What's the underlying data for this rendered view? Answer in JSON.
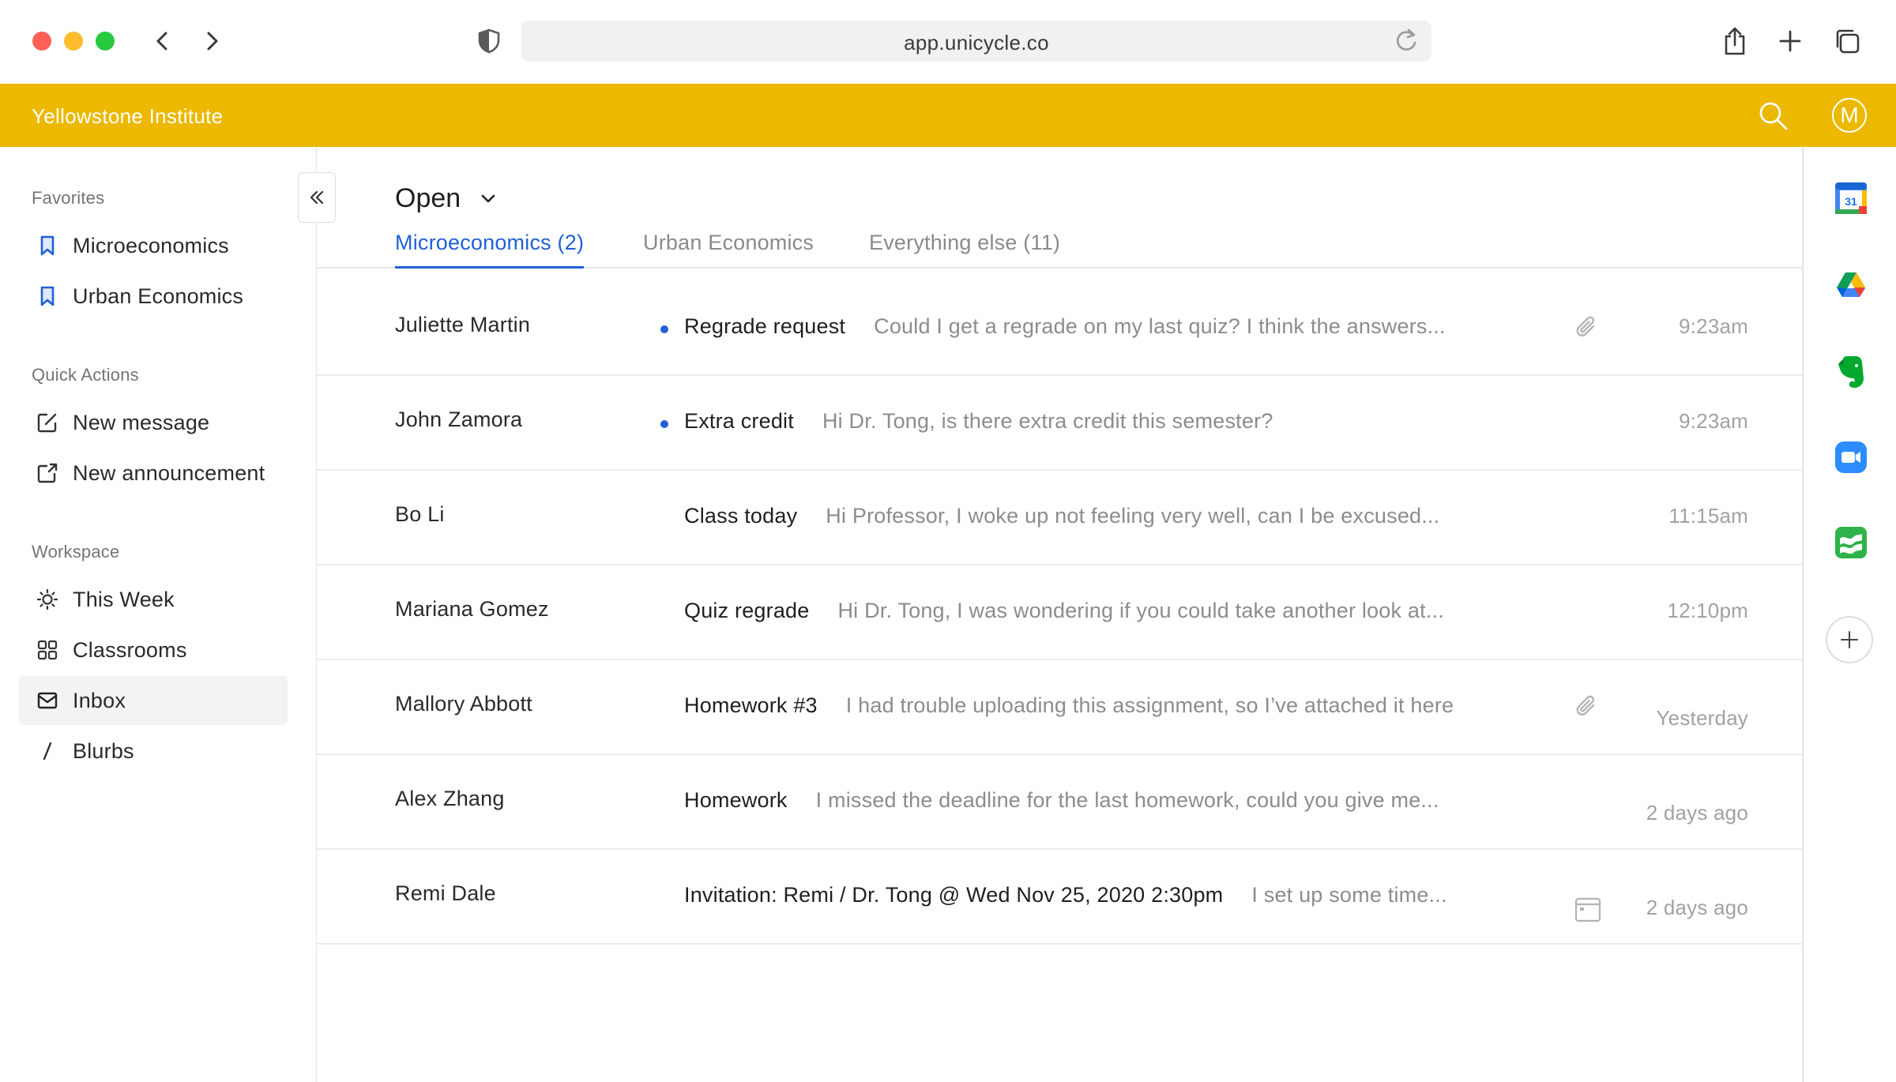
{
  "browser": {
    "url": "app.unicycle.co",
    "icons": [
      "back-icon",
      "forward-icon",
      "shield-icon",
      "reload-icon",
      "share-icon",
      "plus-icon",
      "tabs-icon"
    ]
  },
  "appbar": {
    "org_name": "Yellowstone Institute",
    "avatar_initial": "M",
    "accent_color": "#ecb800"
  },
  "sidebar": {
    "favorites_title": "Favorites",
    "favorites": [
      {
        "label": "Microeconomics",
        "icon": "bookmark-icon"
      },
      {
        "label": "Urban Economics",
        "icon": "bookmark-icon"
      }
    ],
    "quick_actions_title": "Quick Actions",
    "quick_actions": [
      {
        "label": "New message",
        "icon": "compose-icon"
      },
      {
        "label": "New announcement",
        "icon": "announcement-icon"
      }
    ],
    "workspace_title": "Workspace",
    "workspace": [
      {
        "label": "This Week",
        "icon": "sun-icon"
      },
      {
        "label": "Classrooms",
        "icon": "grid-icon"
      },
      {
        "label": "Inbox",
        "icon": "mail-icon",
        "active": true
      },
      {
        "label": "Blurbs",
        "icon": "slash-icon"
      }
    ]
  },
  "main": {
    "view_title": "Open",
    "tabs": [
      {
        "label": "Microeconomics (2)",
        "active": true
      },
      {
        "label": "Urban Economics"
      },
      {
        "label": "Everything else (11)"
      }
    ],
    "messages": [
      {
        "sender": "Juliette Martin",
        "unread": true,
        "subject": "Regrade request",
        "preview": "Could I get a regrade on my last quiz? I think the answers...",
        "icon": "paperclip-icon",
        "time": "9:23am"
      },
      {
        "sender": "John Zamora",
        "unread": true,
        "subject": "Extra credit",
        "preview": "Hi Dr. Tong, is there extra credit this semester?",
        "icon": "",
        "time": "9:23am"
      },
      {
        "sender": "Bo Li",
        "unread": false,
        "subject": "Class today",
        "preview": "Hi Professor, I woke up not feeling very well, can I be excused...",
        "icon": "",
        "time": "11:15am"
      },
      {
        "sender": "Mariana Gomez",
        "unread": false,
        "subject": "Quiz regrade",
        "preview": "Hi Dr. Tong, I was wondering if you could take another look at...",
        "icon": "",
        "time": "12:10pm"
      },
      {
        "sender": "Mallory Abbott",
        "unread": false,
        "subject": "Homework #3",
        "preview": "I had trouble uploading this assignment, so I’ve attached it here",
        "icon": "paperclip-icon",
        "time": "Yesterday"
      },
      {
        "sender": "Alex Zhang",
        "unread": false,
        "subject": "Homework",
        "preview": "I missed the deadline for the last homework, could you give me...",
        "icon": "",
        "time": "2 days ago"
      },
      {
        "sender": "Remi Dale",
        "unread": false,
        "subject": "Invitation: Remi / Dr. Tong @ Wed Nov 25, 2020 2:30pm",
        "preview": "I set up some time...",
        "icon": "calendar-icon",
        "time": "2 days ago"
      }
    ]
  },
  "rail": {
    "calendar_day": "31",
    "apps": [
      "google-calendar-icon",
      "google-drive-icon",
      "evernote-icon",
      "zoom-icon",
      "sheets-icon"
    ]
  }
}
